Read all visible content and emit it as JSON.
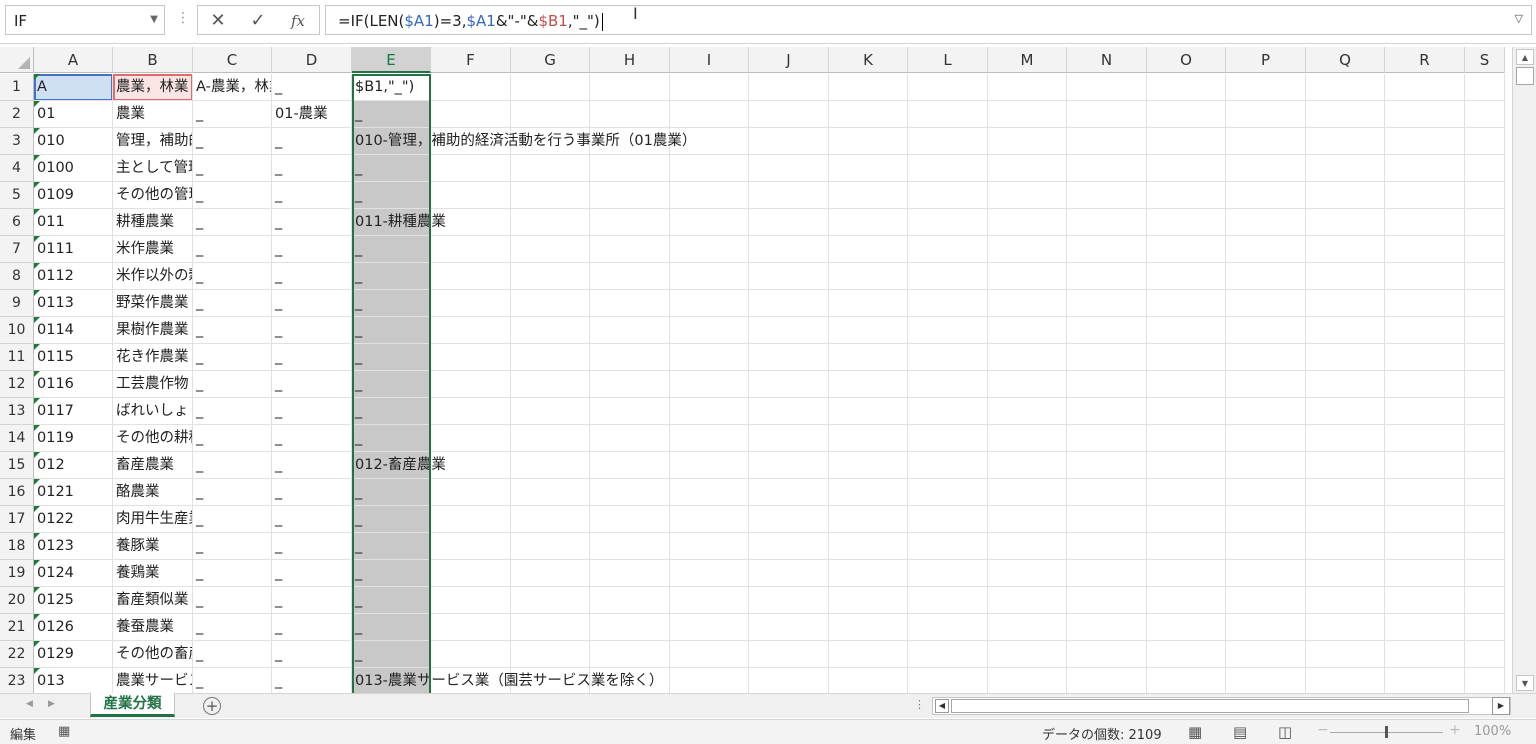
{
  "formula_bar": {
    "name_box": "IF",
    "separator": "⋮",
    "cancel_glyph": "✕",
    "enter_glyph": "✓",
    "fx_label": "fx",
    "formula_parts": [
      {
        "text": "=IF(LEN(",
        "style": "plain"
      },
      {
        "text": "$A1",
        "style": "blue"
      },
      {
        "text": ")=3,",
        "style": "plain"
      },
      {
        "text": "$A1",
        "style": "blue"
      },
      {
        "text": "&\"-\"&",
        "style": "plain"
      },
      {
        "text": "$B1",
        "style": "red"
      },
      {
        "text": ",\"_\")",
        "style": "plain"
      }
    ]
  },
  "columns": [
    "A",
    "B",
    "C",
    "D",
    "E",
    "F",
    "G",
    "H",
    "I",
    "J",
    "K",
    "L",
    "M",
    "N",
    "O",
    "P",
    "Q",
    "R",
    "S"
  ],
  "selected_column": "E",
  "rows": [
    {
      "n": "1",
      "a": "A",
      "b": "農業，林業",
      "c": "A-農業，林業",
      "d": "_",
      "e": "$B1,\"_\")"
    },
    {
      "n": "2",
      "a": "01",
      "b": "農業",
      "c": "_",
      "d": "01-農業",
      "e": "_"
    },
    {
      "n": "3",
      "a": "010",
      "b": "管理，補助的経済活動",
      "c": "_",
      "d": "_",
      "e": "010-管理，補助的経済活動を行う事業所（01農業）"
    },
    {
      "n": "4",
      "a": "0100",
      "b": "主として管理事務",
      "c": "_",
      "d": "_",
      "e": "_"
    },
    {
      "n": "5",
      "a": "0109",
      "b": "その他の管理",
      "c": "_",
      "d": "_",
      "e": "_"
    },
    {
      "n": "6",
      "a": "011",
      "b": "耕種農業",
      "c": "_",
      "d": "_",
      "e": "011-耕種農業"
    },
    {
      "n": "7",
      "a": "0111",
      "b": "米作農業",
      "c": "_",
      "d": "_",
      "e": "_"
    },
    {
      "n": "8",
      "a": "0112",
      "b": "米作以外の穀作",
      "c": "_",
      "d": "_",
      "e": "_"
    },
    {
      "n": "9",
      "a": "0113",
      "b": "野菜作農業",
      "c": "_",
      "d": "_",
      "e": "_"
    },
    {
      "n": "10",
      "a": "0114",
      "b": "果樹作農業",
      "c": "_",
      "d": "_",
      "e": "_"
    },
    {
      "n": "11",
      "a": "0115",
      "b": "花き作農業",
      "c": "_",
      "d": "_",
      "e": "_"
    },
    {
      "n": "12",
      "a": "0116",
      "b": "工芸農作物",
      "c": "_",
      "d": "_",
      "e": "_"
    },
    {
      "n": "13",
      "a": "0117",
      "b": "ばれいしょ",
      "c": "_",
      "d": "_",
      "e": "_"
    },
    {
      "n": "14",
      "a": "0119",
      "b": "その他の耕種",
      "c": "_",
      "d": "_",
      "e": "_"
    },
    {
      "n": "15",
      "a": "012",
      "b": "畜産農業",
      "c": "_",
      "d": "_",
      "e": "012-畜産農業"
    },
    {
      "n": "16",
      "a": "0121",
      "b": "酪農業",
      "c": "_",
      "d": "_",
      "e": "_"
    },
    {
      "n": "17",
      "a": "0122",
      "b": "肉用牛生産業",
      "c": "_",
      "d": "_",
      "e": "_"
    },
    {
      "n": "18",
      "a": "0123",
      "b": "養豚業",
      "c": "_",
      "d": "_",
      "e": "_"
    },
    {
      "n": "19",
      "a": "0124",
      "b": "養鶏業",
      "c": "_",
      "d": "_",
      "e": "_"
    },
    {
      "n": "20",
      "a": "0125",
      "b": "畜産類似業",
      "c": "_",
      "d": "_",
      "e": "_"
    },
    {
      "n": "21",
      "a": "0126",
      "b": "養蚕農業",
      "c": "_",
      "d": "_",
      "e": "_"
    },
    {
      "n": "22",
      "a": "0129",
      "b": "その他の畜産",
      "c": "_",
      "d": "_",
      "e": "_"
    },
    {
      "n": "23",
      "a": "013",
      "b": "農業サービス業",
      "c": "_",
      "d": "_",
      "e": "013-農業サービス業（園芸サービス業を除く）"
    }
  ],
  "sheet_tab": "産業分類",
  "add_sheet": "+",
  "status": {
    "mode": "編集",
    "count_label": "データの個数: 2109",
    "zoom": "100%",
    "zoom_minus": "−",
    "zoom_plus": "+"
  },
  "icons": {
    "cancel": "x-icon",
    "enter": "check-icon",
    "fx": "function-icon",
    "add_sheet": "plus-circle-icon",
    "macro": "macro-record-icon",
    "normal_view": "grid-icon",
    "page_layout": "page-layout-icon",
    "page_break": "page-break-icon"
  },
  "colors": {
    "accent": "#217346",
    "ref_blue": "#3465c8",
    "ref_red": "#c0504d"
  }
}
